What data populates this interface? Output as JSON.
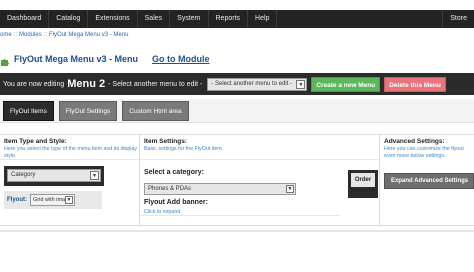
{
  "topnav": {
    "items": [
      "Dashboard",
      "Catalog",
      "Extensions",
      "Sales",
      "System",
      "Reports",
      "Help"
    ],
    "store": "Store"
  },
  "breadcrumb": [
    "ome",
    "Modules",
    "FlyOut Mega Menu v3 - Menu"
  ],
  "title": {
    "page_title": "FlyOut Mega Menu v3 - Menu",
    "goto": "Go to Module"
  },
  "edit_bar": {
    "prefix": "You are now editing",
    "menu_name": "Menu 2",
    "suffix": "- Select another menu to edit -",
    "select_value": "- Select another menu to edit -",
    "create": "Create a new Menu",
    "delete": "Delete this Menu"
  },
  "tabs": [
    "FlyOut Items",
    "FlyOut Settings",
    "Custom Html area"
  ],
  "columns": {
    "item_type": {
      "title": "Item Type and Style:",
      "desc": "Here you select the type of the menu item and its display style.",
      "type_value": "Category",
      "flyout_label": "Flyout:",
      "flyout_value": "Grid with image"
    },
    "item_settings": {
      "title": "Item Settings:",
      "desc": "Basic settings for the FlyOut item.",
      "select_cat_label": "Select a category:",
      "select_cat_value": "Phones & PDAs",
      "banner_label": "Flyout Add banner:",
      "banner_link": "Click to expand",
      "order_label": "Order"
    },
    "advanced": {
      "title": "Advanced Settings:",
      "desc": "Here you can customize the flyout even more below settings.",
      "expand_btn": "Expand Advanced Settings"
    }
  },
  "colors": {
    "accent_blue": "#1f4e8c",
    "link_blue": "#3f86c9",
    "create_green": "#5cb85c",
    "delete_red": "#e8747c",
    "dark": "#2b2b2b"
  }
}
